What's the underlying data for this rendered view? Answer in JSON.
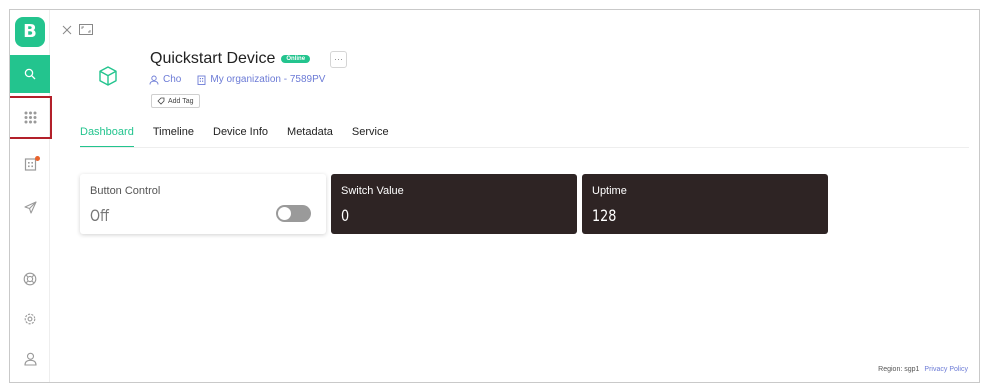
{
  "sidebar": {
    "logo_letter": "B",
    "items": [
      {
        "icon": "search-icon"
      },
      {
        "icon": "grid-icon"
      },
      {
        "icon": "organization-icon"
      },
      {
        "icon": "send-icon"
      },
      {
        "icon": "help-icon"
      },
      {
        "icon": "settings-icon"
      },
      {
        "icon": "user-icon"
      }
    ],
    "accent_color": "#23c48e",
    "highlight_outline_color": "#b3202a",
    "notification_color": "#e8632d"
  },
  "window_controls": {
    "close": "close-icon",
    "expand": "expand-icon"
  },
  "device": {
    "name": "Quickstart Device",
    "status": "Online",
    "owner": "Cho",
    "organization": "My organization - 7589PV",
    "add_tag_label": "Add Tag",
    "more_label": "···"
  },
  "tabs": [
    {
      "label": "Dashboard",
      "active": true
    },
    {
      "label": "Timeline",
      "active": false
    },
    {
      "label": "Device Info",
      "active": false
    },
    {
      "label": "Metadata",
      "active": false
    },
    {
      "label": "Service",
      "active": false
    }
  ],
  "widgets": {
    "button_control": {
      "label": "Button Control",
      "value": "Off",
      "toggle_on": false
    },
    "switch_value": {
      "label": "Switch Value",
      "value": "0"
    },
    "uptime": {
      "label": "Uptime",
      "value": "128"
    }
  },
  "footer": {
    "region": "Region: sgp1",
    "privacy": "Privacy Policy"
  }
}
